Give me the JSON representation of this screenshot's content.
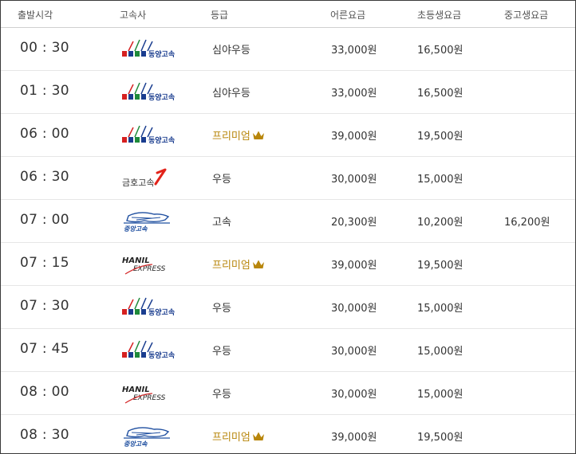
{
  "header": {
    "time": "출발시각",
    "company": "고속사",
    "grade": "등급",
    "adult": "어른요금",
    "child": "초등생요금",
    "teen": "중고생요금"
  },
  "rows": [
    {
      "time": "00 : 30",
      "company": "동양고속",
      "logo": "dongyang",
      "grade": "심야우등",
      "premium": false,
      "adult": "33,000원",
      "child": "16,500원",
      "teen": ""
    },
    {
      "time": "01 : 30",
      "company": "동양고속",
      "logo": "dongyang",
      "grade": "심야우등",
      "premium": false,
      "adult": "33,000원",
      "child": "16,500원",
      "teen": ""
    },
    {
      "time": "06 : 00",
      "company": "동양고속",
      "logo": "dongyang",
      "grade": "프리미엄",
      "premium": true,
      "adult": "39,000원",
      "child": "19,500원",
      "teen": ""
    },
    {
      "time": "06 : 30",
      "company": "금호고속",
      "logo": "kumho",
      "grade": "우등",
      "premium": false,
      "adult": "30,000원",
      "child": "15,000원",
      "teen": ""
    },
    {
      "time": "07 : 00",
      "company": "중앙고속",
      "logo": "jungang",
      "grade": "고속",
      "premium": false,
      "adult": "20,300원",
      "child": "10,200원",
      "teen": "16,200원"
    },
    {
      "time": "07 : 15",
      "company": "HANIL EXPRESS",
      "logo": "hanil",
      "grade": "프리미엄",
      "premium": true,
      "adult": "39,000원",
      "child": "19,500원",
      "teen": ""
    },
    {
      "time": "07 : 30",
      "company": "동양고속",
      "logo": "dongyang",
      "grade": "우등",
      "premium": false,
      "adult": "30,000원",
      "child": "15,000원",
      "teen": ""
    },
    {
      "time": "07 : 45",
      "company": "동양고속",
      "logo": "dongyang",
      "grade": "우등",
      "premium": false,
      "adult": "30,000원",
      "child": "15,000원",
      "teen": ""
    },
    {
      "time": "08 : 00",
      "company": "HANIL EXPRESS",
      "logo": "hanil",
      "grade": "우등",
      "premium": false,
      "adult": "30,000원",
      "child": "15,000원",
      "teen": ""
    },
    {
      "time": "08 : 30",
      "company": "중앙고속",
      "logo": "jungang",
      "grade": "프리미엄",
      "premium": true,
      "adult": "39,000원",
      "child": "19,500원",
      "teen": ""
    }
  ],
  "colors": {
    "premium": "#b8860b",
    "dongyang_blue": "#1a3d8f",
    "dongyang_red": "#d62020",
    "dongyang_green": "#1f8a3a",
    "kumho_red": "#e2231a",
    "jungang_blue": "#1f4fa0",
    "hanil_red": "#d42a2a"
  },
  "icons": {
    "premium": "crown-icon"
  }
}
